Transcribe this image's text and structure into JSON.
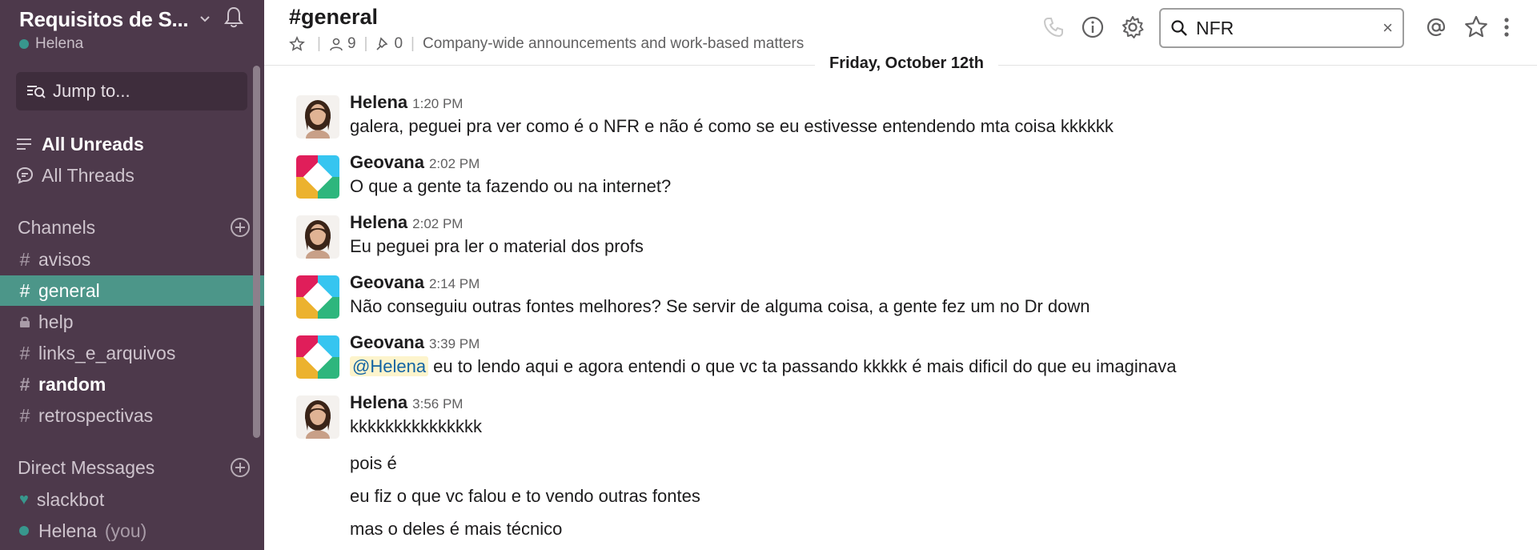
{
  "team": {
    "name": "Requisitos de S...",
    "user": "Helena"
  },
  "sidebar": {
    "jump_label": "Jump to...",
    "all_unreads": "All Unreads",
    "all_threads": "All Threads",
    "channels_heading": "Channels",
    "channels": [
      {
        "name": "avisos",
        "prefix": "#"
      },
      {
        "name": "general",
        "prefix": "#"
      },
      {
        "name": "help",
        "prefix": "lock"
      },
      {
        "name": "links_e_arquivos",
        "prefix": "#"
      },
      {
        "name": "random",
        "prefix": "#"
      },
      {
        "name": "retrospectivas",
        "prefix": "#"
      }
    ],
    "dm_heading": "Direct Messages",
    "dms": [
      {
        "name": "slackbot"
      },
      {
        "name": "Helena",
        "suffix": "(you)"
      }
    ]
  },
  "header": {
    "channel": "#general",
    "members": "9",
    "pins": "0",
    "topic": "Company-wide announcements and work-based matters",
    "search_value": "NFR",
    "search_clear": "×"
  },
  "date_divider": "Friday, October 12th",
  "messages": [
    {
      "author": "Helena",
      "time": "1:20 PM",
      "text": "galera, peguei pra ver como é o NFR e não é como se eu estivesse entendendo mta coisa kkkkkk"
    },
    {
      "author": "Geovana",
      "time": "2:02 PM",
      "text": "O que a gente ta fazendo ou na internet?"
    },
    {
      "author": "Helena",
      "time": "2:02 PM",
      "text": "Eu peguei pra ler o material dos profs"
    },
    {
      "author": "Geovana",
      "time": "2:14 PM",
      "text": "Não conseguiu outras fontes melhores? Se servir de alguma coisa, a gente fez um no Dr down"
    },
    {
      "author": "Geovana",
      "time": "3:39 PM",
      "mention": "@Helena",
      "text": " eu to lendo aqui e agora entendi o que vc ta passando kkkkk é mais dificil do que eu imaginava"
    },
    {
      "author": "Helena",
      "time": "3:56 PM",
      "text": "kkkkkkkkkkkkkkk"
    }
  ],
  "continuations": [
    "pois é",
    "eu fiz o que vc falou e to vendo outras fontes",
    "mas o deles é mais técnico"
  ],
  "colors": {
    "sidebar_bg": "#4d394b",
    "active_channel": "#4c9689",
    "presence": "#38978d",
    "mention_bg": "#fdf4cc",
    "mention_fg": "#1264a3"
  }
}
